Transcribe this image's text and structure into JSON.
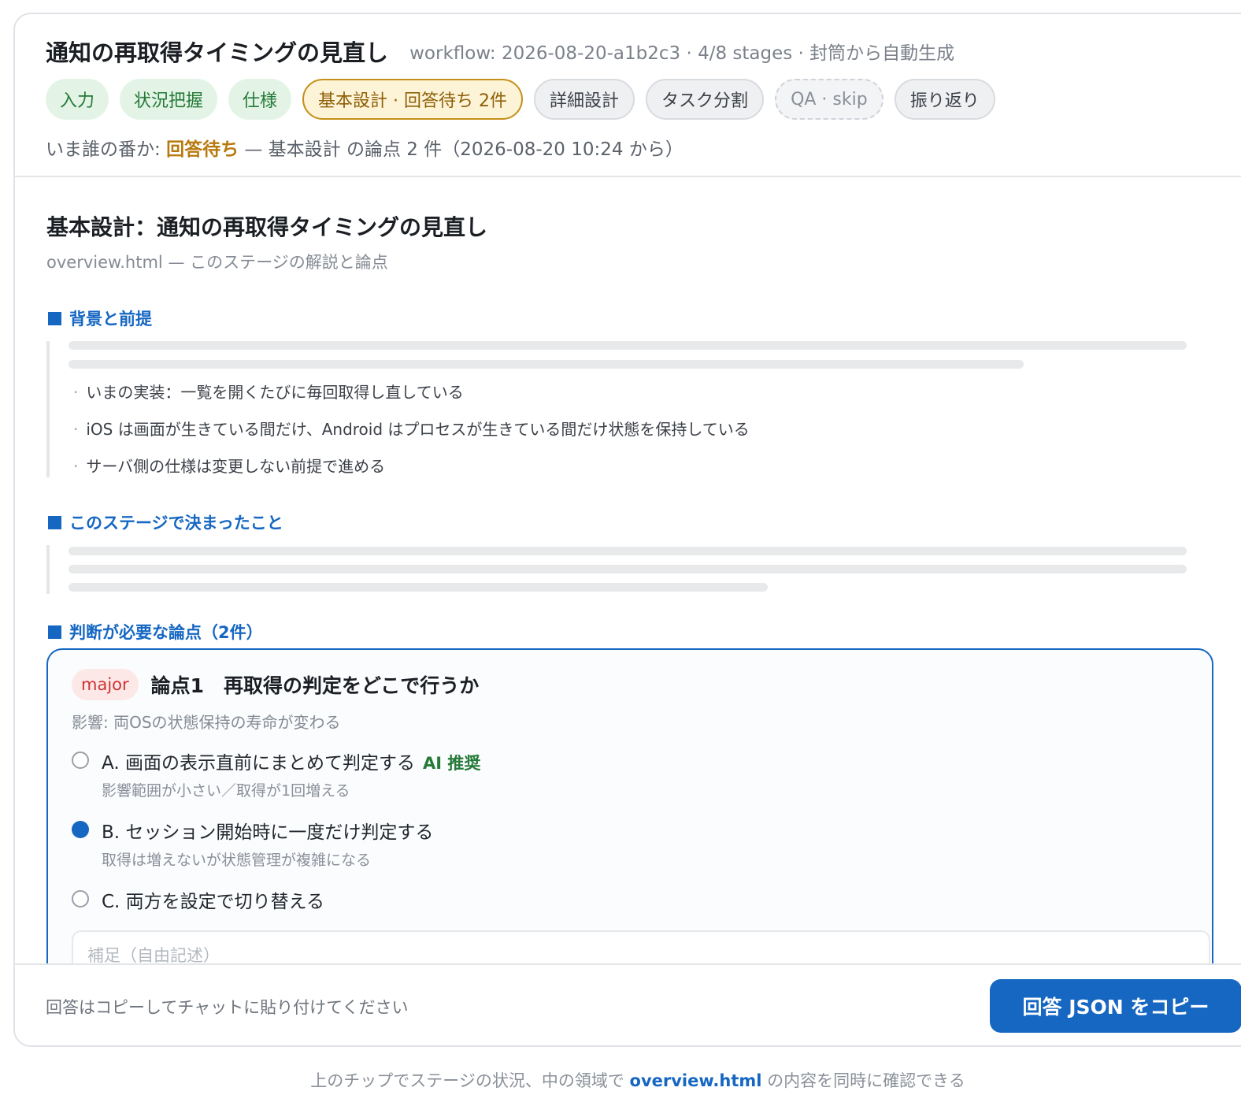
{
  "header": {
    "title": "通知の再取得タイミングの見直し",
    "meta": "workflow: 2026-08-20-a1b2c3 · 4/8 stages · 封筒から自動生成",
    "chips": [
      {
        "label": "入力",
        "state": "done"
      },
      {
        "label": "状況把握",
        "state": "done"
      },
      {
        "label": "仕様",
        "state": "done"
      },
      {
        "label": "基本設計 · 回答待ち 2件",
        "state": "current"
      },
      {
        "label": "詳細設計",
        "state": "todo"
      },
      {
        "label": "タスク分割",
        "state": "todo"
      },
      {
        "label": "QA · skip",
        "state": "skip"
      },
      {
        "label": "振り返り",
        "state": "todo"
      }
    ],
    "turn": {
      "prefix": "いま誰の番か: ",
      "status": "回答待ち",
      "detail": " — 基本設計 の論点 2 件（2026-08-20 10:24 から）"
    }
  },
  "content": {
    "stage_title": "基本設計：通知の再取得タイミングの見直し",
    "stage_subtitle": "overview.html — このステージの解説と論点",
    "sections": {
      "background": {
        "heading": "背景と前提",
        "bullets": [
          "いまの実装：一覧を開くたびに毎回取得し直している",
          "iOS は画面が生きている間だけ、Android はプロセスが生きている間だけ状態を保持している",
          "サーバ側の仕様は変更しない前提で進める"
        ]
      },
      "decided": {
        "heading": "このステージで決まったこと"
      },
      "issues": {
        "heading": "判断が必要な論点（2件）"
      }
    },
    "issue": {
      "severity": "major",
      "title": "論点1　再取得の判定をどこで行うか",
      "impact": "影響: 両OSの状態保持の寿命が変わる",
      "options": [
        {
          "label": "A. 画面の表示直前にまとめて判定する",
          "tag": "AI 推奨",
          "note": "影響範囲が小さい／取得が1回増える",
          "selected": false
        },
        {
          "label": "B. セッション開始時に一度だけ判定する",
          "tag": "",
          "note": "取得は増えないが状態管理が複雑になる",
          "selected": true
        },
        {
          "label": "C. 両方を設定で切り替える",
          "tag": "",
          "note": "",
          "selected": false
        }
      ],
      "note_placeholder": "補足（自由記述）"
    }
  },
  "footer": {
    "hint": "回答はコピーしてチャットに貼り付けてください",
    "copy_button": "回答 JSON をコピー"
  },
  "caption": {
    "before": "上のチップでステージの状況、中の領域で ",
    "link": "overview.html",
    "after": " の内容を同時に確認できる"
  },
  "colors": {
    "accent": "#1667c2",
    "done": "#257a38",
    "waiting": "#b7790d",
    "major": "#cf3232"
  }
}
